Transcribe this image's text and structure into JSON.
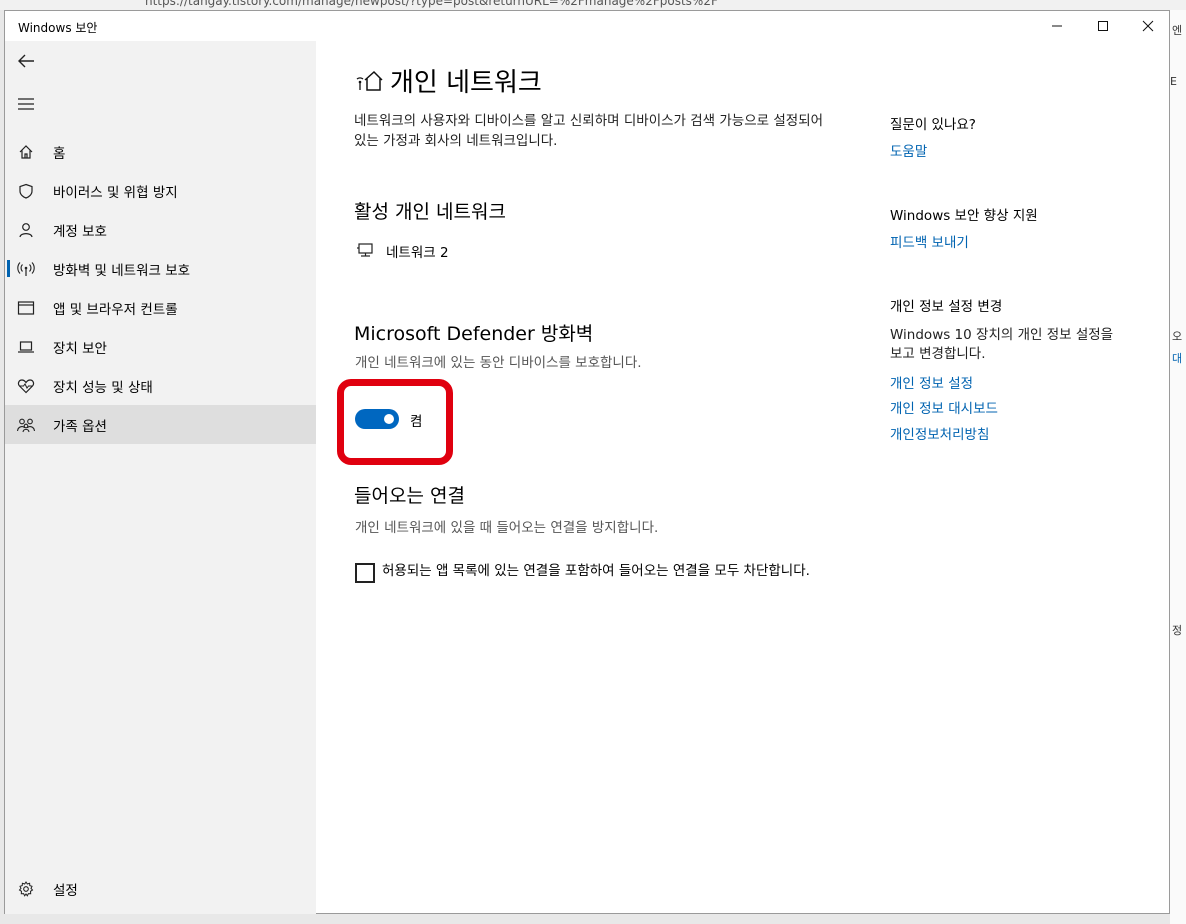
{
  "app": {
    "title": "Windows 보안"
  },
  "nav": {
    "items": [
      {
        "id": "home",
        "label": "홈",
        "icon": "home-icon"
      },
      {
        "id": "virus",
        "label": "바이러스 및 위협 방지",
        "icon": "shield-icon"
      },
      {
        "id": "account",
        "label": "계정 보호",
        "icon": "person-icon"
      },
      {
        "id": "firewall",
        "label": "방화벽 및 네트워크 보호",
        "icon": "antenna-icon"
      },
      {
        "id": "app",
        "label": "앱 및 브라우저 컨트롤",
        "icon": "browser-icon"
      },
      {
        "id": "device",
        "label": "장치 보안",
        "icon": "laptop-icon"
      },
      {
        "id": "perf",
        "label": "장치 성능 및 상태",
        "icon": "heart-icon"
      },
      {
        "id": "family",
        "label": "가족 옵션",
        "icon": "family-icon"
      }
    ],
    "settings_label": "설정"
  },
  "page": {
    "title": "개인 네트워크",
    "description": "네트워크의 사용자와 디바이스를 알고 신뢰하며 디바이스가 검색 가능으로 설정되어 있는 가정과 회사의 네트워크입니다.",
    "active_heading": "활성 개인 네트워크",
    "network_name": "네트워크 2",
    "firewall_heading": "Microsoft Defender 방화벽",
    "firewall_sub": "개인 네트워크에 있는 동안 디바이스를 보호합니다.",
    "toggle_label": "켬",
    "toggle_on": true,
    "incoming_heading": "들어오는 연결",
    "incoming_sub": "개인 네트워크에 있을 때 들어오는 연결을 방지합니다.",
    "block_label": "허용되는 앱 목록에 있는 연결을 포함하여 들어오는 연결을 모두 차단합니다.",
    "block_checked": false
  },
  "right": {
    "question": "질문이 있나요?",
    "help_link": "도움말",
    "improve": "Windows 보안 향상 지원",
    "feedback_link": "피드백 보내기",
    "privacy_heading": "개인 정보 설정 변경",
    "privacy_text": "Windows 10 장치의 개인 정보 설정을 보고 변경합니다.",
    "privacy_links": [
      "개인 정보 설정",
      "개인 정보 대시보드",
      "개인정보처리방침"
    ]
  },
  "colors": {
    "accent": "#0067c0",
    "link": "#0063b1",
    "highlight": "#e0000f"
  }
}
